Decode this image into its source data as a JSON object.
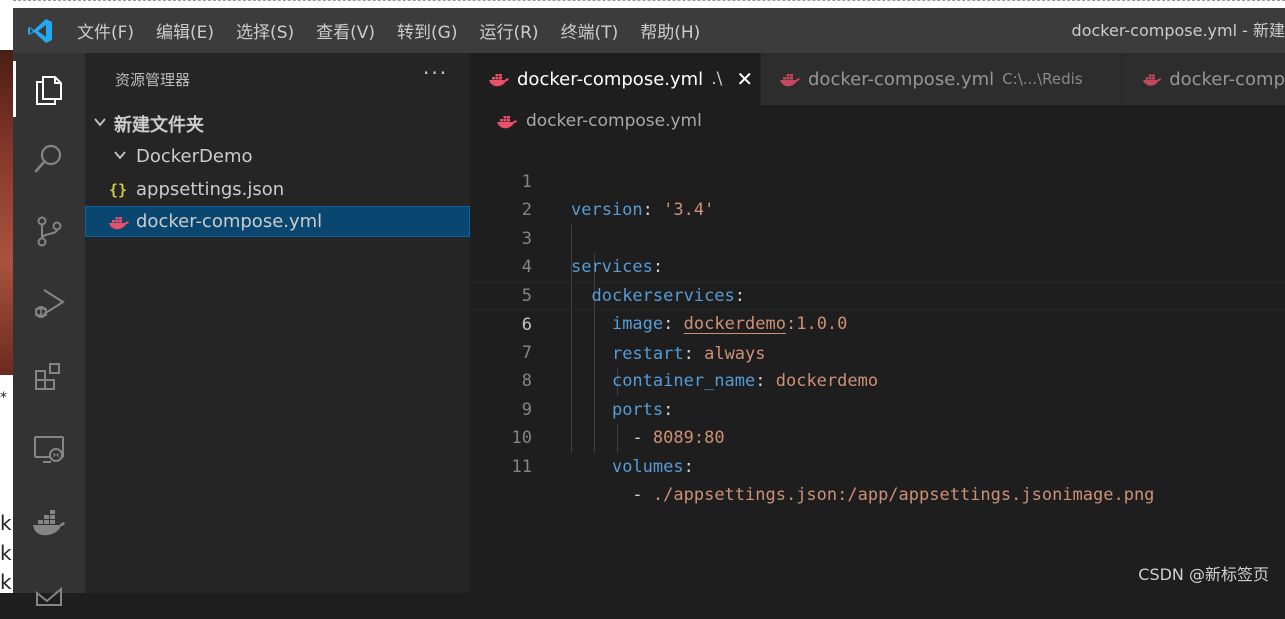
{
  "background": {
    "left_text": [
      "*",
      "k",
      "k",
      "k"
    ]
  },
  "titlebar": {
    "menu": [
      "文件(F)",
      "编辑(E)",
      "选择(S)",
      "查看(V)",
      "转到(G)",
      "运行(R)",
      "终端(T)",
      "帮助(H)"
    ],
    "window_title": "docker-compose.yml - 新建"
  },
  "activity_bar": {
    "items": [
      "explorer-icon",
      "search-icon",
      "source-control-icon",
      "run-debug-icon",
      "extensions-icon",
      "remote-explorer-icon",
      "docker-icon",
      "azure-icon"
    ]
  },
  "sidebar": {
    "title": "资源管理器",
    "more": "···",
    "folder": "新建文件夹",
    "subfolder": "DockerDemo",
    "files": [
      {
        "name": "appsettings.json",
        "icon": "{}"
      },
      {
        "name": "docker-compose.yml",
        "icon": "docker-icon"
      }
    ]
  },
  "tabs": [
    {
      "label": "docker-compose.yml",
      "desc": ".\\",
      "close": "✕",
      "active": true
    },
    {
      "label": "docker-compose.yml",
      "desc": "C:\\...\\Redis",
      "active": false
    },
    {
      "label": "docker-comp",
      "desc": "",
      "active": false
    }
  ],
  "breadcrumb": "docker-compose.yml",
  "code": {
    "current_line": 6,
    "line_numbers": [
      "1",
      "2",
      "3",
      "4",
      "5",
      "6",
      "7",
      "8",
      "9",
      "10",
      "11"
    ],
    "l1": {
      "key": "version",
      "colon": ": ",
      "val": "'3.4'"
    },
    "l3": {
      "key": "services",
      "colon": ":"
    },
    "l4": {
      "key": "dockerservices",
      "colon": ":"
    },
    "l5": {
      "key": "image",
      "colon": ": ",
      "val_a": "dockerdemo",
      "val_b": ":1.0.0"
    },
    "l6": {
      "key": "restart",
      "colon": ": ",
      "val": "always"
    },
    "l7": {
      "key": "container_name",
      "colon": ": ",
      "val": "dockerdemo"
    },
    "l8": {
      "key": "ports",
      "colon": ":"
    },
    "l9": {
      "dash": "- ",
      "val": "8089:80"
    },
    "l10": {
      "key": "volumes",
      "colon": ":"
    },
    "l11": {
      "dash": "- ",
      "val": "./appsettings.json:/app/appsettings.jsonimage.png"
    }
  },
  "watermark": "CSDN @新标签页",
  "colors": {
    "keyword": "#569cd6",
    "string": "#ce9178",
    "docker_file_icon": "#e8516b",
    "json_icon": "#cbcb41",
    "vscode_blue": "#23a9f2"
  }
}
